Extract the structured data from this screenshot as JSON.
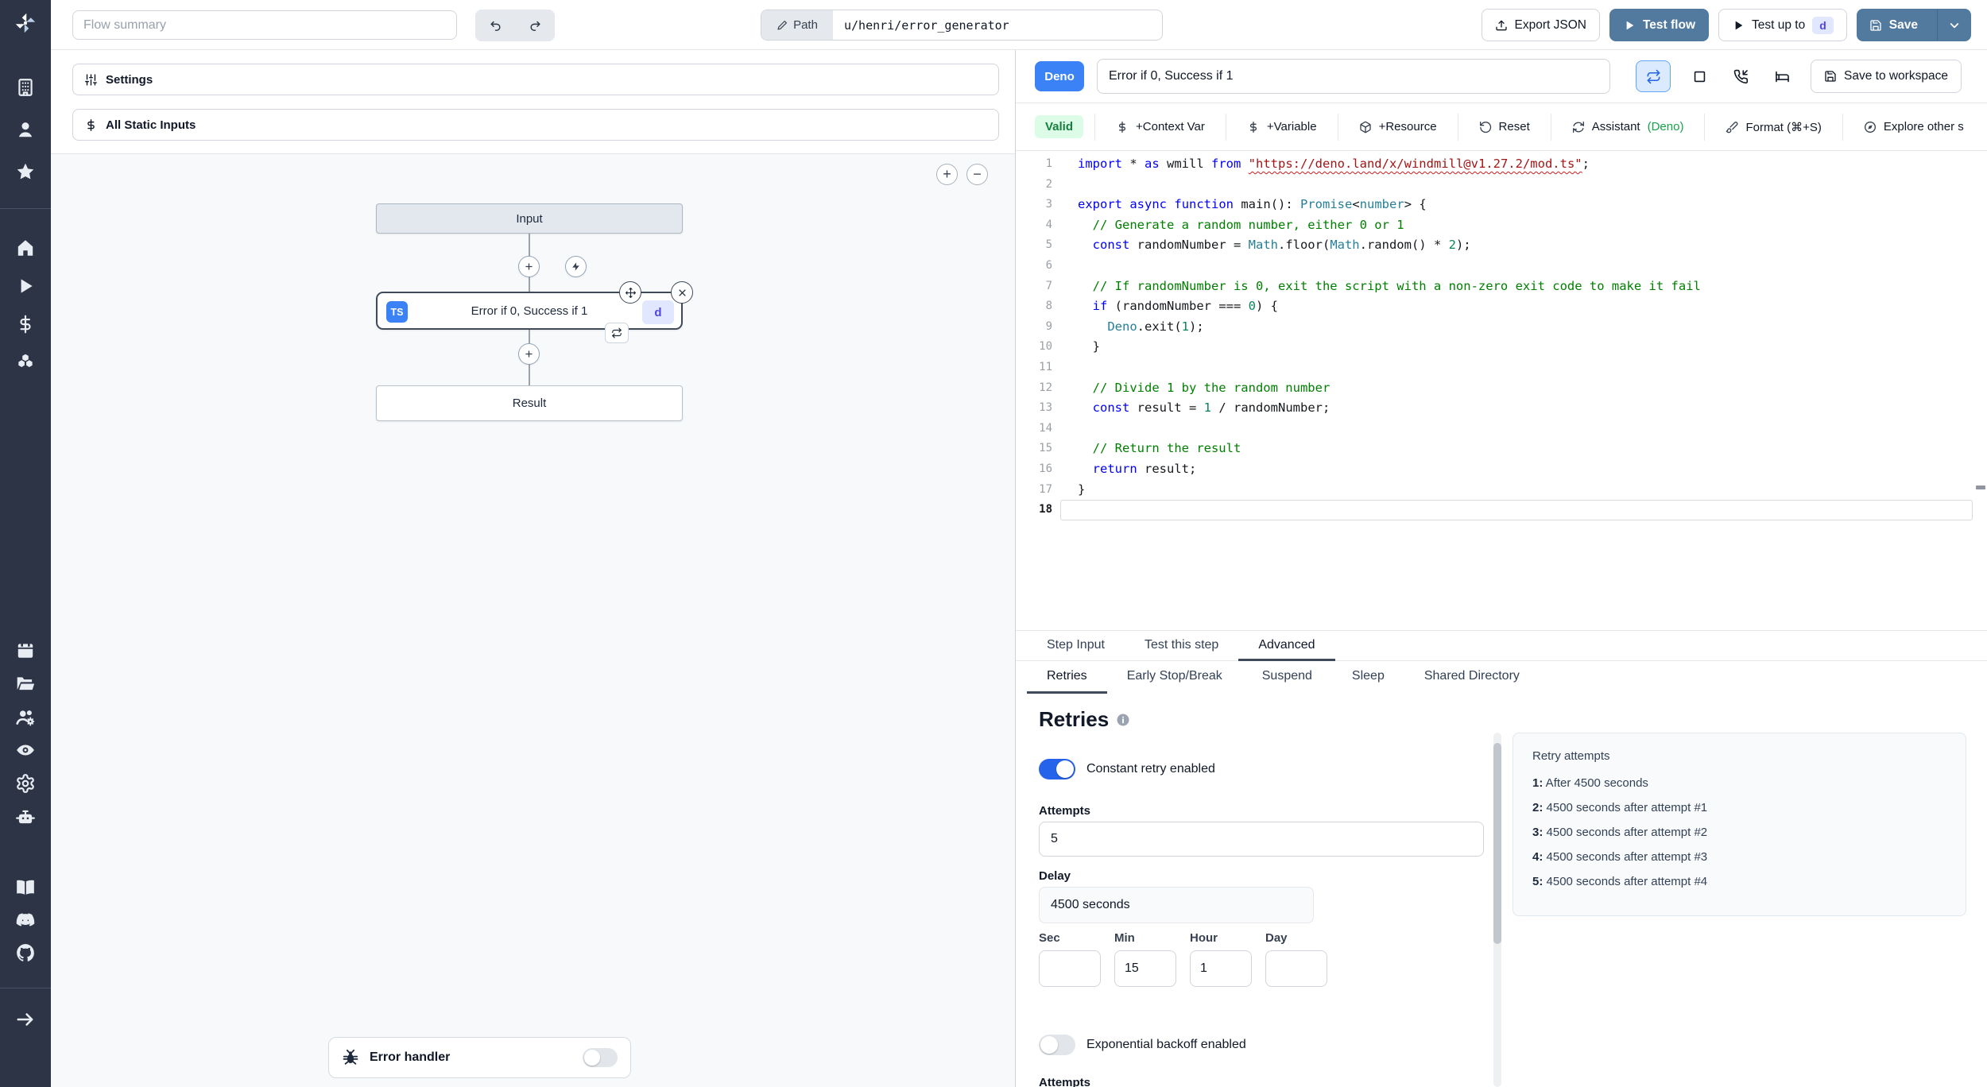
{
  "topbar": {
    "flow_summary_placeholder": "Flow summary",
    "path_label": "Path",
    "path_value": "u/henri/error_generator",
    "export_json_label": "Export JSON",
    "test_flow_label": "Test flow",
    "test_up_to_label": "Test up to",
    "test_up_to_badge": "d",
    "save_label": "Save"
  },
  "sidebar": {
    "icons_top": [
      "building",
      "user",
      "star"
    ],
    "icons_mid": [
      "home",
      "play",
      "dollar",
      "boxes"
    ],
    "icons_tools": [
      "calendar",
      "folder-open",
      "users-cog",
      "eye",
      "gear",
      "bot"
    ],
    "icons_links": [
      "book",
      "discord",
      "github"
    ],
    "expand_icon": "arrow-right"
  },
  "flow_panel": {
    "settings_label": "Settings",
    "static_inputs_label": "All Static Inputs",
    "zoom_in_label": "+",
    "zoom_out_label": "−",
    "input_node_label": "Input",
    "step_node": {
      "lang_badge": "TS",
      "title": "Error if 0, Success if 1",
      "id_badge": "d"
    },
    "result_node_label": "Result",
    "error_handler_label": "Error handler"
  },
  "editor": {
    "lang_badge": "Deno",
    "summary_value": "Error if 0, Success if 1",
    "save_to_workspace_label": "Save to workspace",
    "valid_badge": "Valid",
    "toolbar": [
      {
        "icon": "dollar",
        "label": "+Context Var"
      },
      {
        "icon": "dollar",
        "label": "+Variable"
      },
      {
        "icon": "package",
        "label": "+Resource"
      },
      {
        "icon": "rotate-ccw",
        "label": "Reset"
      },
      {
        "icon": "refresh-cw",
        "label": "Assistant ",
        "suffix": "(Deno)"
      },
      {
        "icon": "brush",
        "label": "Format (⌘+S)"
      },
      {
        "icon": "compass",
        "label": "Explore other s"
      }
    ],
    "current_line": 18,
    "code_lines": [
      [
        {
          "t": "import",
          "c": "kw"
        },
        {
          "t": " * ",
          "c": "pl"
        },
        {
          "t": "as",
          "c": "kw"
        },
        {
          "t": " wmill ",
          "c": "pl"
        },
        {
          "t": "from",
          "c": "kw"
        },
        {
          "t": " ",
          "c": "pl"
        },
        {
          "t": "\"https://deno.land/x/windmill@v1.27.2/mod.ts\"",
          "c": "str sq"
        },
        {
          "t": ";",
          "c": "pl"
        }
      ],
      [],
      [
        {
          "t": "export",
          "c": "kw"
        },
        {
          "t": " ",
          "c": "pl"
        },
        {
          "t": "async",
          "c": "kw"
        },
        {
          "t": " ",
          "c": "pl"
        },
        {
          "t": "function",
          "c": "kw"
        },
        {
          "t": " main",
          "c": "pl"
        },
        {
          "t": "(): ",
          "c": "pl"
        },
        {
          "t": "Promise",
          "c": "ty"
        },
        {
          "t": "<",
          "c": "pl"
        },
        {
          "t": "number",
          "c": "ty"
        },
        {
          "t": "> {",
          "c": "pl"
        }
      ],
      [
        {
          "t": "  ",
          "c": "pl"
        },
        {
          "t": "// Generate a random number, either 0 or 1",
          "c": "cm"
        }
      ],
      [
        {
          "t": "  ",
          "c": "pl"
        },
        {
          "t": "const",
          "c": "kw"
        },
        {
          "t": " randomNumber = ",
          "c": "pl"
        },
        {
          "t": "Math",
          "c": "ty"
        },
        {
          "t": ".floor(",
          "c": "pl"
        },
        {
          "t": "Math",
          "c": "ty"
        },
        {
          "t": ".random() * ",
          "c": "pl"
        },
        {
          "t": "2",
          "c": "num"
        },
        {
          "t": ");",
          "c": "pl"
        }
      ],
      [],
      [
        {
          "t": "  ",
          "c": "pl"
        },
        {
          "t": "// If randomNumber is 0, exit the script with a non-zero exit code to make it fail",
          "c": "cm"
        }
      ],
      [
        {
          "t": "  ",
          "c": "pl"
        },
        {
          "t": "if",
          "c": "kw"
        },
        {
          "t": " (randomNumber === ",
          "c": "pl"
        },
        {
          "t": "0",
          "c": "num"
        },
        {
          "t": ") {",
          "c": "pl"
        }
      ],
      [
        {
          "t": "    ",
          "c": "pl"
        },
        {
          "t": "Deno",
          "c": "ty"
        },
        {
          "t": ".exit(",
          "c": "pl"
        },
        {
          "t": "1",
          "c": "num"
        },
        {
          "t": ");",
          "c": "pl"
        }
      ],
      [
        {
          "t": "  }",
          "c": "pl"
        }
      ],
      [],
      [
        {
          "t": "  ",
          "c": "pl"
        },
        {
          "t": "// Divide 1 by the random number",
          "c": "cm"
        }
      ],
      [
        {
          "t": "  ",
          "c": "pl"
        },
        {
          "t": "const",
          "c": "kw"
        },
        {
          "t": " result = ",
          "c": "pl"
        },
        {
          "t": "1",
          "c": "num"
        },
        {
          "t": " / randomNumber;",
          "c": "pl"
        }
      ],
      [],
      [
        {
          "t": "  ",
          "c": "pl"
        },
        {
          "t": "// Return the result",
          "c": "cm"
        }
      ],
      [
        {
          "t": "  ",
          "c": "pl"
        },
        {
          "t": "return",
          "c": "kw"
        },
        {
          "t": " result;",
          "c": "pl"
        }
      ],
      [
        {
          "t": "}",
          "c": "pl"
        }
      ],
      []
    ]
  },
  "panel_tabs": [
    {
      "label": "Step Input",
      "active": false
    },
    {
      "label": "Test this step",
      "active": false
    },
    {
      "label": "Advanced",
      "active": true
    }
  ],
  "advanced_tabs": [
    {
      "label": "Retries",
      "active": true
    },
    {
      "label": "Early Stop/Break",
      "active": false
    },
    {
      "label": "Suspend",
      "active": false
    },
    {
      "label": "Sleep",
      "active": false
    },
    {
      "label": "Shared Directory",
      "active": false
    }
  ],
  "retries": {
    "title": "Retries",
    "constant_toggle_label": "Constant retry enabled",
    "constant_toggle_on": true,
    "attempts_label": "Attempts",
    "attempts_value": "5",
    "delay_label": "Delay",
    "delay_value": "4500 seconds",
    "time_fields": [
      {
        "label": "Sec",
        "value": ""
      },
      {
        "label": "Min",
        "value": "15"
      },
      {
        "label": "Hour",
        "value": "1"
      },
      {
        "label": "Day",
        "value": ""
      }
    ],
    "exponential_toggle_label": "Exponential backoff enabled",
    "exponential_toggle_on": false,
    "clipped_label": "Attempts",
    "preview": {
      "title": "Retry attempts",
      "items": [
        {
          "n": "1:",
          "text": "After 4500 seconds"
        },
        {
          "n": "2:",
          "text": "4500 seconds after attempt #1"
        },
        {
          "n": "3:",
          "text": "4500 seconds after attempt #2"
        },
        {
          "n": "4:",
          "text": "4500 seconds after attempt #3"
        },
        {
          "n": "5:",
          "text": "4500 seconds after attempt #4"
        }
      ]
    }
  },
  "colors": {
    "sidebar_bg": "#2d3446",
    "action_blue": "#527a9e",
    "badge_blue": "#3b82f6",
    "toggle_on_blue": "#2563eb",
    "valid_green_bg": "#dcfce7",
    "valid_green_text": "#15803d",
    "deno_suffix_green": "#16a34a",
    "id_badge_bg": "#e0e7ff",
    "id_badge_text": "#4f46e5"
  }
}
